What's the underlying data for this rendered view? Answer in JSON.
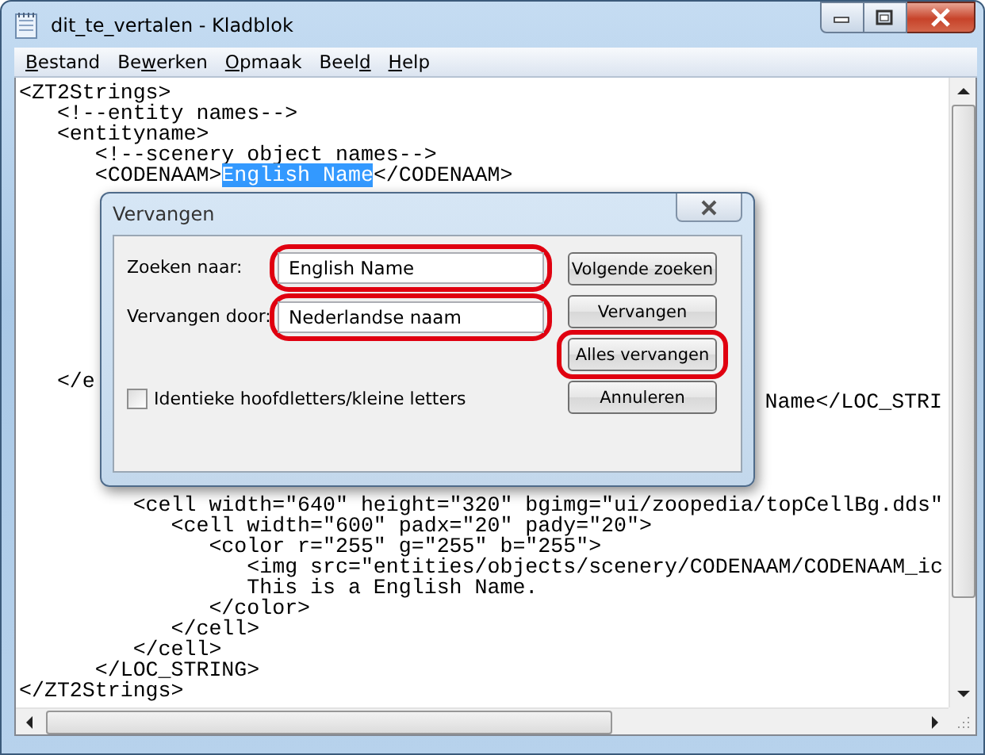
{
  "window": {
    "title": "dit_te_vertalen - Kladblok"
  },
  "menu": [
    {
      "key": "B",
      "after": "estand"
    },
    {
      "before": "Be",
      "key": "w",
      "after": "erken"
    },
    {
      "key": "O",
      "after": "pmaak"
    },
    {
      "before": "Beel",
      "key": "d"
    },
    {
      "key": "H",
      "after": "elp"
    }
  ],
  "editor": {
    "sections": [
      {
        "lines": [
          [
            {
              "text": "<ZT2Strings>",
              "selected": false
            }
          ],
          [
            {
              "text": "   <!--entity names-->",
              "selected": false
            }
          ],
          [
            {
              "text": "   <entityname>",
              "selected": false
            }
          ],
          [
            {
              "text": "      <!--scenery object names-->",
              "selected": false
            }
          ],
          [
            {
              "text": "      <CODENAAM>",
              "selected": false
            },
            {
              "text": "English Name",
              "selected": true
            },
            {
              "text": "</CODENAAM>",
              "selected": false
            }
          ]
        ]
      },
      {
        "lines": [
          [
            {
              "text": "   </e",
              "selected": false
            }
          ],
          [
            {
              "text": "Name</LOC_STRI",
              "selected": false
            }
          ]
        ]
      },
      {
        "lines": [
          [
            {
              "text": "         <cell width=\"640\" height=\"320\" bgimg=\"ui/zoopedia/topCellBg.dds\"",
              "selected": false
            }
          ],
          [
            {
              "text": "            <cell width=\"600\" padx=\"20\" pady=\"20\">",
              "selected": false
            }
          ],
          [
            {
              "text": "               <color r=\"255\" g=\"255\" b=\"255\">",
              "selected": false
            }
          ],
          [
            {
              "text": "                  <img src=\"entities/objects/scenery/CODENAAM/CODENAAM_ic",
              "selected": false
            }
          ],
          [
            {
              "text": "                  This is a English Name.",
              "selected": false
            }
          ],
          [
            {
              "text": "               </color>",
              "selected": false
            }
          ],
          [
            {
              "text": "            </cell>",
              "selected": false
            }
          ],
          [
            {
              "text": "         </cell>",
              "selected": false
            }
          ],
          [
            {
              "text": "      </LOC_STRING>",
              "selected": false
            }
          ],
          [
            {
              "text": "</ZT2Strings>",
              "selected": false
            }
          ]
        ]
      }
    ]
  },
  "dialog": {
    "title": "Vervangen",
    "fields": [
      {
        "label": "Zoeken naar:",
        "value": "English Name",
        "highlighted": true
      },
      {
        "label": "Vervangen door:",
        "value": "Nederlandse naam",
        "highlighted": true
      }
    ],
    "buttons": [
      {
        "label": "Volgende zoeken",
        "highlighted": false
      },
      {
        "label": "Vervangen",
        "highlighted": false
      },
      {
        "label": "Alles vervangen",
        "highlighted": true
      },
      {
        "label": "Annuleren",
        "highlighted": false
      }
    ],
    "checkbox": {
      "label": "Identieke hoofdletters/kleine letters",
      "checked": false
    }
  }
}
